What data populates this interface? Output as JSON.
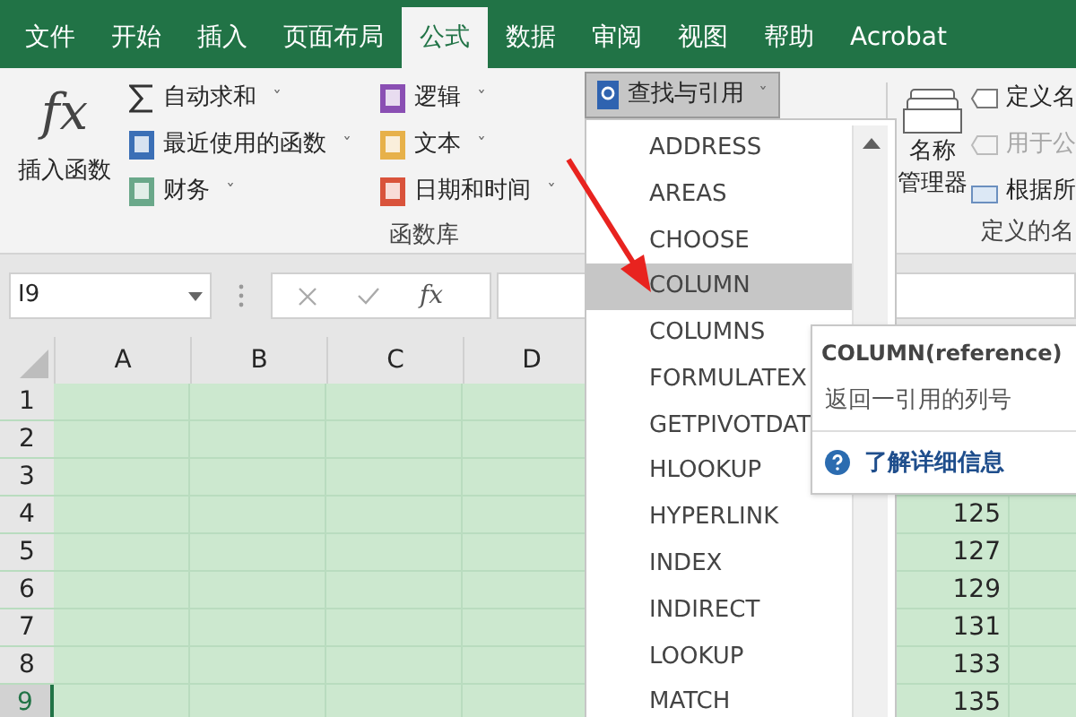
{
  "tabs": [
    {
      "label": "文件",
      "selected": false
    },
    {
      "label": "开始",
      "selected": false
    },
    {
      "label": "插入",
      "selected": false
    },
    {
      "label": "页面布局",
      "selected": false
    },
    {
      "label": "公式",
      "selected": true
    },
    {
      "label": "数据",
      "selected": false
    },
    {
      "label": "审阅",
      "selected": false
    },
    {
      "label": "视图",
      "selected": false
    },
    {
      "label": "帮助",
      "selected": false
    },
    {
      "label": "Acrobat",
      "selected": false
    }
  ],
  "ribbon": {
    "insert_function": {
      "icon": "fx",
      "label": "插入函数"
    },
    "function_library": {
      "label": "函数库",
      "column_1": [
        {
          "label": "自动求和",
          "caret": "ˇ"
        },
        {
          "label": "最近使用的函数",
          "caret": "ˇ"
        },
        {
          "label": "财务",
          "caret": "ˇ"
        }
      ],
      "column_2": [
        {
          "label": "逻辑",
          "caret": "ˇ"
        },
        {
          "label": "文本",
          "caret": "ˇ"
        },
        {
          "label": "日期和时间",
          "caret": "ˇ"
        }
      ],
      "lookup_button": {
        "label": "查找与引用",
        "caret": "ˇ",
        "expanded": true
      }
    },
    "defined_names": {
      "label": "定义的名",
      "name_manager": [
        "名称",
        "管理器"
      ],
      "items": [
        {
          "label": "定义名",
          "disabled": false
        },
        {
          "label": "用于公",
          "disabled": true
        },
        {
          "label": "根据所",
          "disabled": false
        }
      ]
    }
  },
  "formula_bar": {
    "name_box": "I9",
    "fx": "fx"
  },
  "sheet": {
    "columns": [
      "A",
      "B",
      "C",
      "D"
    ],
    "rows": [
      {
        "header": "1",
        "selected": false
      },
      {
        "header": "2",
        "selected": false
      },
      {
        "header": "3",
        "selected": false
      },
      {
        "header": "4",
        "selected": false,
        "value": "125"
      },
      {
        "header": "5",
        "selected": false,
        "value": "127"
      },
      {
        "header": "6",
        "selected": false,
        "value": "129"
      },
      {
        "header": "7",
        "selected": false,
        "value": "131"
      },
      {
        "header": "8",
        "selected": false,
        "value": "133"
      },
      {
        "header": "9",
        "selected": true,
        "value": "135"
      }
    ]
  },
  "dropdown": {
    "items": [
      {
        "label": "ADDRESS",
        "selected": false
      },
      {
        "label": "AREAS",
        "selected": false
      },
      {
        "label": "CHOOSE",
        "selected": false
      },
      {
        "label": "COLUMN",
        "selected": true
      },
      {
        "label": "COLUMNS",
        "selected": false
      },
      {
        "label": "FORMULATEX",
        "selected": false
      },
      {
        "label": "GETPIVOTDAT",
        "selected": false
      },
      {
        "label": "HLOOKUP",
        "selected": false
      },
      {
        "label": "HYPERLINK",
        "selected": false
      },
      {
        "label": "INDEX",
        "selected": false
      },
      {
        "label": "INDIRECT",
        "selected": false
      },
      {
        "label": "LOOKUP",
        "selected": false
      },
      {
        "label": "MATCH",
        "selected": false
      }
    ]
  },
  "tooltip": {
    "title": "COLUMN(reference)",
    "description": "返回一引用的列号",
    "link": "了解详细信息"
  }
}
